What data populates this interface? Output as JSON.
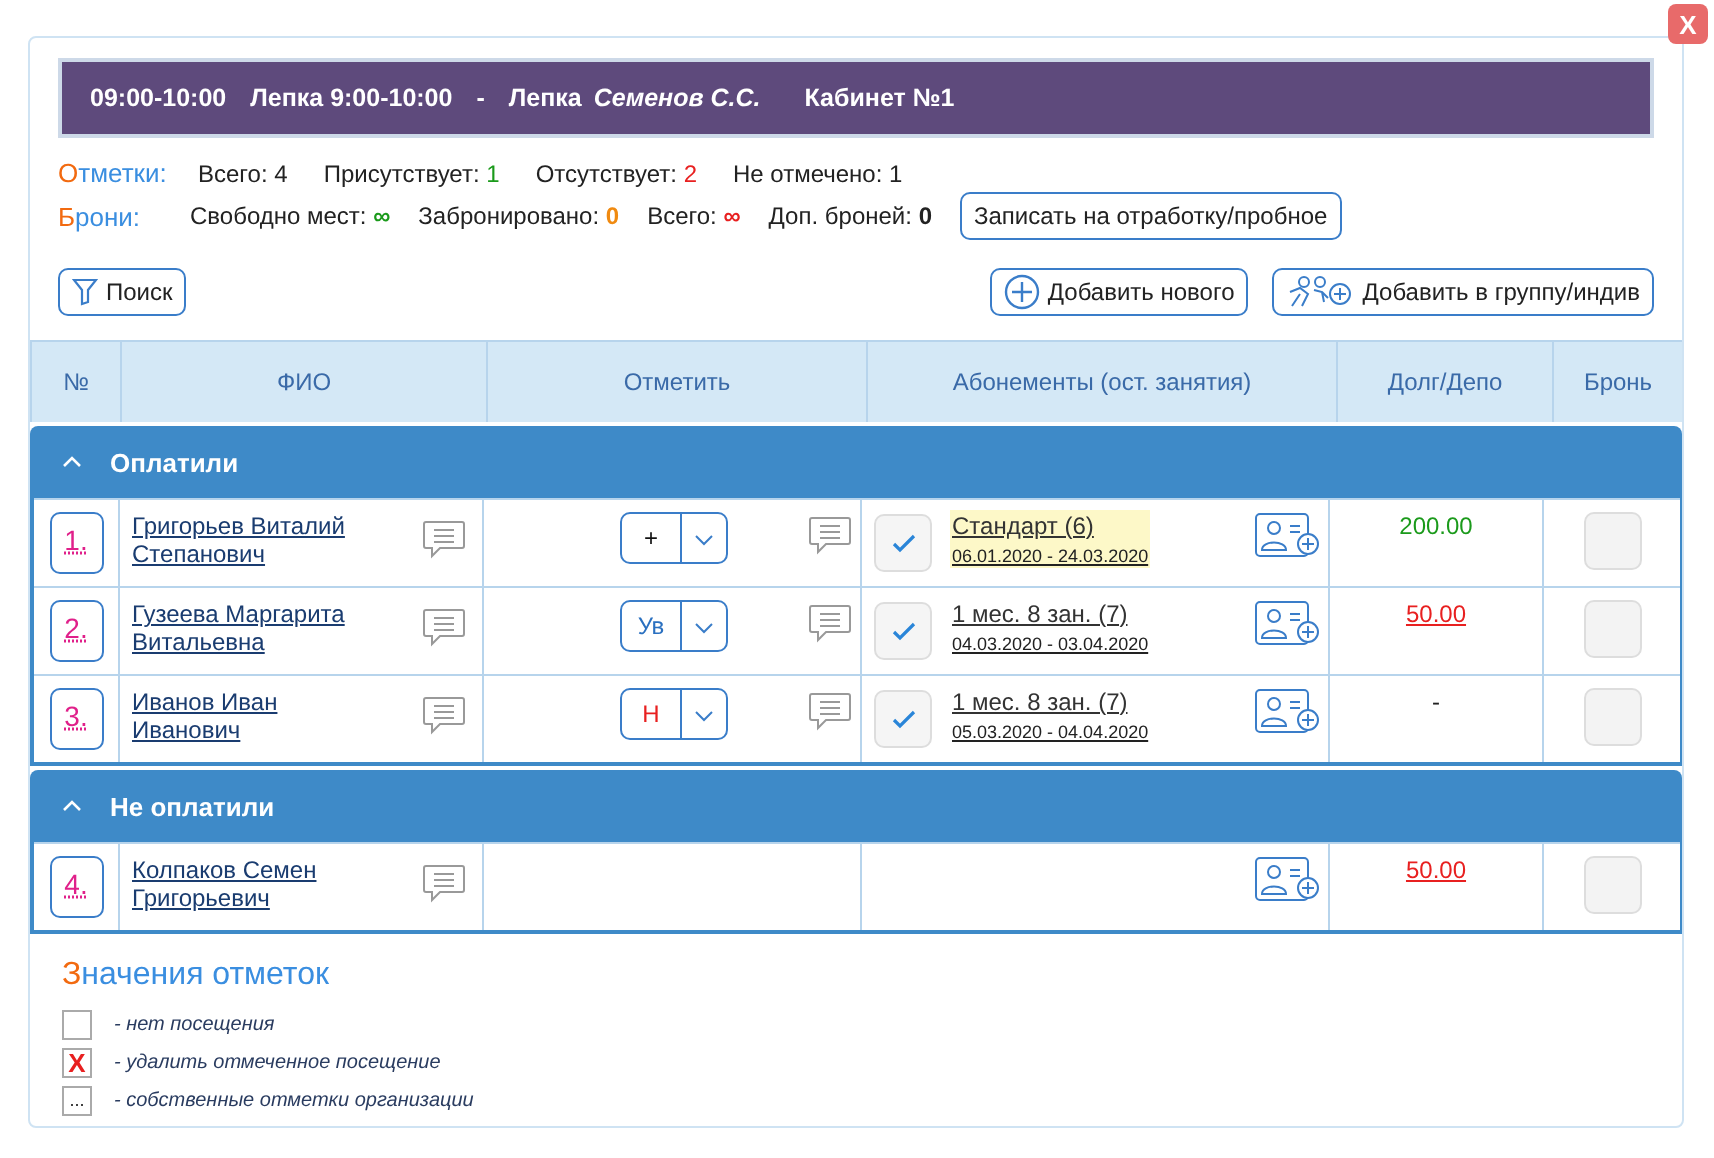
{
  "close": "X",
  "header": {
    "time": "09:00-10:00",
    "lesson": "Лепка 9:00-10:00",
    "separator": "-",
    "subject": "Лепка",
    "teacher": "Семенов С.С.",
    "room": "Кабинет №1"
  },
  "marks_summary": {
    "title": "Отметки:",
    "items": [
      {
        "label": "Всего:",
        "value": "4",
        "color": "#222222"
      },
      {
        "label": "Присутствует:",
        "value": "1",
        "color": "#1b9a1b"
      },
      {
        "label": "Отсутствует:",
        "value": "2",
        "color": "#e82020"
      },
      {
        "label": "Не отмечено:",
        "value": "1",
        "color": "#222222"
      }
    ]
  },
  "bookings_summary": {
    "title": "Брони:",
    "items": [
      {
        "label": "Свободно мест:",
        "value": "∞",
        "color": "#1b9a1b"
      },
      {
        "label": "Забронировано:",
        "value": "0",
        "color": "#f08a10"
      },
      {
        "label": "Всего:",
        "value": "∞",
        "color": "#e82020"
      },
      {
        "label": "Доп. броней:",
        "value": "0",
        "color": "#222222"
      }
    ],
    "button": "Записать на отработку/пробное"
  },
  "toolbar": {
    "search": "Поиск",
    "add_new": "Добавить нового",
    "add_to_group": "Добавить в группу/индив"
  },
  "table": {
    "columns": [
      "№",
      "ФИО",
      "Отметить",
      "Абонементы (ост. занятия)",
      "Долг/Депо",
      "Бронь"
    ],
    "groups": [
      {
        "title": "Оплатили",
        "expanded": true,
        "rows": [
          {
            "number": "1.",
            "name": "Григорьев Виталий Степанович",
            "mark": {
              "value": "+",
              "kind": "present"
            },
            "subscription": {
              "checked": true,
              "title": "Стандарт (6)",
              "dates": "06.01.2020 - 24.03.2020",
              "highlighted": true
            },
            "balance": {
              "value": "200.00",
              "kind": "deposit"
            },
            "booked": false
          },
          {
            "number": "2.",
            "name": "Гузеева Маргарита Витальевна",
            "mark": {
              "value": "Ув",
              "kind": "excused"
            },
            "subscription": {
              "checked": true,
              "title": "1 мес. 8 зан. (7)",
              "dates": "04.03.2020 - 03.04.2020",
              "highlighted": false
            },
            "balance": {
              "value": "50.00",
              "kind": "debt"
            },
            "booked": false
          },
          {
            "number": "3.",
            "name": "Иванов Иван Иванович",
            "mark": {
              "value": "Н",
              "kind": "absent"
            },
            "subscription": {
              "checked": true,
              "title": "1 мес. 8 зан. (7)",
              "dates": "05.03.2020 - 04.04.2020",
              "highlighted": false
            },
            "balance": {
              "value": "-",
              "kind": "none"
            },
            "booked": false
          }
        ]
      },
      {
        "title": "Не оплатили",
        "expanded": true,
        "rows": [
          {
            "number": "4.",
            "name": "Колпаков Семен Григорьевич",
            "balance": {
              "value": "50.00",
              "kind": "debt"
            },
            "booked": false
          }
        ]
      }
    ]
  },
  "legend": {
    "title": "Значения отметок",
    "items": [
      {
        "kind": "empty",
        "text": "- нет посещения"
      },
      {
        "kind": "delete",
        "symbol": "X",
        "text": "- удалить отмеченное посещение"
      },
      {
        "kind": "custom",
        "symbol": "...",
        "text": "- собственные отметки организации"
      }
    ]
  }
}
